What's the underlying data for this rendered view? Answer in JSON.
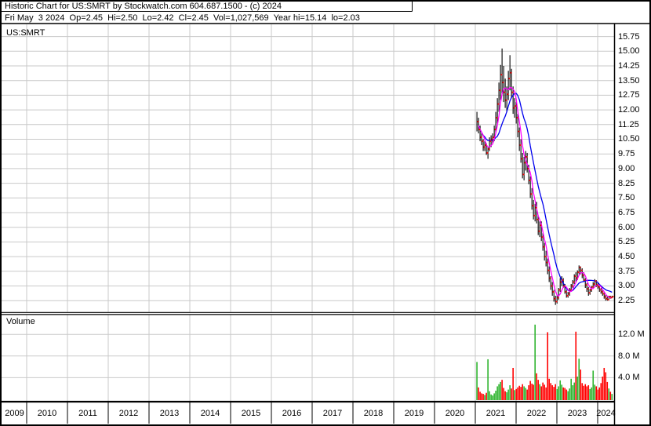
{
  "header": {
    "title": "Historic Chart for US:SMRT by Stockwatch.com 604.687.1500 - (c) 2024",
    "quote_line": "Fri May  3 2024  Op=2.45  Hi=2.50  Lo=2.42  Cl=2.45  Vol=1,027,569  Year hi=15.14  lo=2.03"
  },
  "price_pane": {
    "symbol_label": "US:SMRT"
  },
  "volume_pane": {
    "label": "Volume"
  },
  "colors": {
    "grid": "#c9c9c9",
    "bar": "#000000",
    "ma_short": "#ff00ff",
    "ma_long": "#0000ee",
    "close_dot": "#ff0000",
    "volume_up": "#2eb42e",
    "volume_down": "#ff0000",
    "frame": "#000000"
  },
  "chart_data": {
    "type": "ohlc",
    "title": "US:SMRT historic daily chart with volume",
    "legend_position": "none",
    "grid": true,
    "x_axis": {
      "years": [
        "2009",
        "2010",
        "2011",
        "2012",
        "2013",
        "2014",
        "2015",
        "2016",
        "2017",
        "2018",
        "2019",
        "2020",
        "2021",
        "2022",
        "2023",
        "2024"
      ],
      "start": 2009.42,
      "end": 2024.4
    },
    "price_axis": {
      "ticks": [
        15.75,
        15.0,
        14.25,
        13.5,
        12.75,
        12.0,
        11.25,
        10.5,
        9.75,
        9.0,
        8.25,
        7.5,
        6.75,
        6.0,
        5.25,
        4.5,
        3.75,
        3.0,
        2.25
      ],
      "min": 2.0,
      "max": 16.0,
      "period_high": 15.14,
      "period_low": 2.03
    },
    "volume_axis": {
      "ticks_millions": [
        12,
        8,
        4
      ],
      "labels": [
        "12.0 M",
        "8.0 M",
        "4.0 M"
      ]
    },
    "moving_averages": {
      "short_window_bars": 5,
      "long_window_bars": 13
    },
    "bars_format": [
      "t_decimal_year",
      "open",
      "high",
      "low",
      "close",
      "volume_millions"
    ],
    "bars": [
      [
        2021.04,
        11.2,
        11.9,
        10.9,
        11.4,
        6.9
      ],
      [
        2021.078,
        11.4,
        11.6,
        10.8,
        11.0,
        2.2
      ],
      [
        2021.117,
        11.0,
        11.2,
        10.4,
        10.6,
        1.4
      ],
      [
        2021.155,
        10.6,
        10.8,
        10.2,
        10.4,
        1.1
      ],
      [
        2021.194,
        10.4,
        10.5,
        9.9,
        10.1,
        1.0
      ],
      [
        2021.232,
        10.1,
        10.4,
        9.9,
        10.2,
        0.8
      ],
      [
        2021.271,
        10.2,
        10.3,
        9.7,
        9.8,
        1.2
      ],
      [
        2021.31,
        9.8,
        10.1,
        9.5,
        10.0,
        7.4
      ],
      [
        2021.348,
        10.0,
        10.6,
        9.9,
        10.4,
        1.5
      ],
      [
        2021.387,
        10.4,
        10.7,
        10.1,
        10.5,
        0.9
      ],
      [
        2021.425,
        10.5,
        10.8,
        10.3,
        10.6,
        0.7
      ],
      [
        2021.464,
        10.6,
        11.2,
        10.4,
        11.0,
        1.1
      ],
      [
        2021.502,
        11.0,
        11.9,
        10.8,
        11.6,
        1.6
      ],
      [
        2021.541,
        11.6,
        12.6,
        11.3,
        12.3,
        2.4
      ],
      [
        2021.579,
        12.3,
        13.4,
        11.9,
        13.0,
        2.8
      ],
      [
        2021.618,
        13.0,
        14.3,
        12.5,
        13.8,
        3.2
      ],
      [
        2021.656,
        13.8,
        15.14,
        12.8,
        13.4,
        3.6
      ],
      [
        2021.695,
        13.4,
        14.25,
        12.4,
        12.9,
        2.1
      ],
      [
        2021.733,
        12.9,
        13.6,
        12.1,
        12.5,
        1.5
      ],
      [
        2021.772,
        12.5,
        13.2,
        11.9,
        12.8,
        1.3
      ],
      [
        2021.81,
        12.8,
        14.0,
        12.5,
        13.6,
        1.8
      ],
      [
        2021.849,
        13.6,
        14.8,
        13.0,
        13.9,
        2.6
      ],
      [
        2021.887,
        13.9,
        14.1,
        12.6,
        12.9,
        2.0
      ],
      [
        2021.926,
        12.9,
        13.2,
        11.8,
        12.1,
        5.8
      ],
      [
        2021.964,
        12.1,
        12.6,
        11.6,
        12.2,
        1.7
      ],
      [
        2022.003,
        12.2,
        12.4,
        11.3,
        11.6,
        1.9
      ],
      [
        2022.041,
        11.6,
        11.8,
        10.6,
        10.9,
        2.2
      ],
      [
        2022.08,
        10.9,
        11.1,
        9.9,
        10.2,
        2.5
      ],
      [
        2022.118,
        10.2,
        10.5,
        9.3,
        9.5,
        2.3
      ],
      [
        2022.157,
        9.5,
        9.8,
        8.5,
        8.7,
        2.8
      ],
      [
        2022.195,
        8.7,
        9.6,
        8.4,
        9.3,
        2.4
      ],
      [
        2022.234,
        9.3,
        9.9,
        8.9,
        9.6,
        2.1
      ],
      [
        2022.272,
        9.6,
        9.8,
        8.8,
        9.0,
        1.8
      ],
      [
        2022.311,
        9.0,
        9.2,
        8.2,
        8.4,
        2.6
      ],
      [
        2022.349,
        8.4,
        8.6,
        7.5,
        7.7,
        3.4
      ],
      [
        2022.388,
        7.7,
        8.0,
        6.9,
        7.1,
        2.9
      ],
      [
        2022.426,
        7.1,
        7.4,
        6.4,
        6.6,
        2.7
      ],
      [
        2022.465,
        6.6,
        7.2,
        6.3,
        7.0,
        13.8
      ],
      [
        2022.503,
        7.0,
        7.3,
        6.2,
        6.4,
        4.8
      ],
      [
        2022.542,
        6.4,
        6.6,
        5.6,
        5.8,
        3.6
      ],
      [
        2022.58,
        5.8,
        6.3,
        5.5,
        6.1,
        2.8
      ],
      [
        2022.619,
        6.1,
        6.3,
        5.3,
        5.5,
        2.4
      ],
      [
        2022.657,
        5.5,
        5.7,
        4.8,
        5.0,
        3.1
      ],
      [
        2022.696,
        5.0,
        5.2,
        4.3,
        4.5,
        2.7
      ],
      [
        2022.734,
        4.5,
        4.8,
        4.0,
        4.2,
        2.2
      ],
      [
        2022.773,
        4.2,
        4.4,
        3.6,
        3.8,
        12.4
      ],
      [
        2022.811,
        3.8,
        4.0,
        3.2,
        3.4,
        3.8
      ],
      [
        2022.85,
        3.4,
        3.5,
        2.8,
        3.0,
        3.0
      ],
      [
        2022.888,
        3.0,
        3.2,
        2.5,
        2.7,
        2.6
      ],
      [
        2022.927,
        2.7,
        2.8,
        2.2,
        2.35,
        2.3
      ],
      [
        2022.965,
        2.35,
        2.5,
        2.03,
        2.2,
        2.8
      ],
      [
        2023.004,
        2.2,
        2.5,
        2.1,
        2.4,
        1.9
      ],
      [
        2023.042,
        2.4,
        2.9,
        2.3,
        2.8,
        2.4
      ],
      [
        2023.081,
        2.8,
        3.4,
        2.7,
        3.2,
        3.5
      ],
      [
        2023.119,
        3.2,
        3.5,
        3.0,
        3.3,
        2.7
      ],
      [
        2023.158,
        3.3,
        3.4,
        2.9,
        3.0,
        2.2
      ],
      [
        2023.196,
        3.0,
        3.1,
        2.6,
        2.7,
        2.1
      ],
      [
        2023.235,
        2.7,
        2.8,
        2.4,
        2.5,
        1.8
      ],
      [
        2023.273,
        2.5,
        2.7,
        2.4,
        2.6,
        1.5
      ],
      [
        2023.312,
        2.6,
        2.9,
        2.5,
        2.8,
        2.0
      ],
      [
        2023.35,
        2.8,
        3.1,
        2.7,
        3.0,
        3.8
      ],
      [
        2023.389,
        3.0,
        3.3,
        2.9,
        3.2,
        2.6
      ],
      [
        2023.427,
        3.2,
        3.6,
        3.1,
        3.5,
        3.1
      ],
      [
        2023.466,
        3.5,
        3.7,
        3.2,
        3.4,
        12.5
      ],
      [
        2023.504,
        3.4,
        3.8,
        3.3,
        3.7,
        4.2
      ],
      [
        2023.543,
        3.7,
        4.05,
        3.6,
        3.95,
        7.5
      ],
      [
        2023.581,
        3.95,
        4.0,
        3.6,
        3.8,
        5.5
      ],
      [
        2023.62,
        3.8,
        3.9,
        3.4,
        3.55,
        3.0
      ],
      [
        2023.658,
        3.55,
        3.7,
        3.2,
        3.3,
        2.5
      ],
      [
        2023.697,
        3.3,
        3.4,
        2.9,
        3.05,
        2.8
      ],
      [
        2023.735,
        3.05,
        3.15,
        2.7,
        2.85,
        2.4
      ],
      [
        2023.774,
        2.85,
        2.95,
        2.5,
        2.65,
        2.6
      ],
      [
        2023.812,
        2.65,
        2.85,
        2.55,
        2.8,
        1.9
      ],
      [
        2023.851,
        2.8,
        3.0,
        2.7,
        2.95,
        2.2
      ],
      [
        2023.889,
        2.95,
        3.2,
        2.85,
        3.1,
        5.3
      ],
      [
        2023.928,
        3.1,
        3.35,
        3.0,
        3.25,
        2.7
      ],
      [
        2023.966,
        3.25,
        3.3,
        2.95,
        3.05,
        2.4
      ],
      [
        2024.005,
        3.05,
        3.15,
        2.85,
        2.95,
        1.8
      ],
      [
        2024.043,
        2.95,
        3.0,
        2.7,
        2.8,
        2.2
      ],
      [
        2024.082,
        2.8,
        2.9,
        2.6,
        2.7,
        3.0
      ],
      [
        2024.12,
        2.7,
        2.8,
        2.5,
        2.6,
        4.2
      ],
      [
        2024.159,
        2.6,
        2.7,
        2.35,
        2.45,
        5.8
      ],
      [
        2024.197,
        2.45,
        2.55,
        2.25,
        2.35,
        5.0
      ],
      [
        2024.236,
        2.35,
        2.45,
        2.25,
        2.3,
        3.2
      ],
      [
        2024.274,
        2.3,
        2.5,
        2.28,
        2.45,
        2.0
      ],
      [
        2024.313,
        2.45,
        2.5,
        2.35,
        2.4,
        1.4
      ],
      [
        2024.351,
        2.4,
        2.5,
        2.38,
        2.45,
        1.0
      ]
    ]
  }
}
